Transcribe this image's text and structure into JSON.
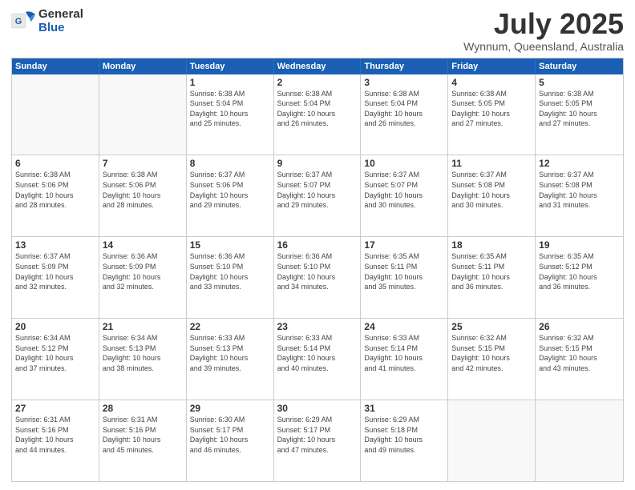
{
  "header": {
    "logo_general": "General",
    "logo_blue": "Blue",
    "month": "July 2025",
    "location": "Wynnum, Queensland, Australia"
  },
  "weekdays": [
    "Sunday",
    "Monday",
    "Tuesday",
    "Wednesday",
    "Thursday",
    "Friday",
    "Saturday"
  ],
  "weeks": [
    [
      {
        "day": "",
        "info": ""
      },
      {
        "day": "",
        "info": ""
      },
      {
        "day": "1",
        "info": "Sunrise: 6:38 AM\nSunset: 5:04 PM\nDaylight: 10 hours\nand 25 minutes."
      },
      {
        "day": "2",
        "info": "Sunrise: 6:38 AM\nSunset: 5:04 PM\nDaylight: 10 hours\nand 26 minutes."
      },
      {
        "day": "3",
        "info": "Sunrise: 6:38 AM\nSunset: 5:04 PM\nDaylight: 10 hours\nand 26 minutes."
      },
      {
        "day": "4",
        "info": "Sunrise: 6:38 AM\nSunset: 5:05 PM\nDaylight: 10 hours\nand 27 minutes."
      },
      {
        "day": "5",
        "info": "Sunrise: 6:38 AM\nSunset: 5:05 PM\nDaylight: 10 hours\nand 27 minutes."
      }
    ],
    [
      {
        "day": "6",
        "info": "Sunrise: 6:38 AM\nSunset: 5:06 PM\nDaylight: 10 hours\nand 28 minutes."
      },
      {
        "day": "7",
        "info": "Sunrise: 6:38 AM\nSunset: 5:06 PM\nDaylight: 10 hours\nand 28 minutes."
      },
      {
        "day": "8",
        "info": "Sunrise: 6:37 AM\nSunset: 5:06 PM\nDaylight: 10 hours\nand 29 minutes."
      },
      {
        "day": "9",
        "info": "Sunrise: 6:37 AM\nSunset: 5:07 PM\nDaylight: 10 hours\nand 29 minutes."
      },
      {
        "day": "10",
        "info": "Sunrise: 6:37 AM\nSunset: 5:07 PM\nDaylight: 10 hours\nand 30 minutes."
      },
      {
        "day": "11",
        "info": "Sunrise: 6:37 AM\nSunset: 5:08 PM\nDaylight: 10 hours\nand 30 minutes."
      },
      {
        "day": "12",
        "info": "Sunrise: 6:37 AM\nSunset: 5:08 PM\nDaylight: 10 hours\nand 31 minutes."
      }
    ],
    [
      {
        "day": "13",
        "info": "Sunrise: 6:37 AM\nSunset: 5:09 PM\nDaylight: 10 hours\nand 32 minutes."
      },
      {
        "day": "14",
        "info": "Sunrise: 6:36 AM\nSunset: 5:09 PM\nDaylight: 10 hours\nand 32 minutes."
      },
      {
        "day": "15",
        "info": "Sunrise: 6:36 AM\nSunset: 5:10 PM\nDaylight: 10 hours\nand 33 minutes."
      },
      {
        "day": "16",
        "info": "Sunrise: 6:36 AM\nSunset: 5:10 PM\nDaylight: 10 hours\nand 34 minutes."
      },
      {
        "day": "17",
        "info": "Sunrise: 6:35 AM\nSunset: 5:11 PM\nDaylight: 10 hours\nand 35 minutes."
      },
      {
        "day": "18",
        "info": "Sunrise: 6:35 AM\nSunset: 5:11 PM\nDaylight: 10 hours\nand 36 minutes."
      },
      {
        "day": "19",
        "info": "Sunrise: 6:35 AM\nSunset: 5:12 PM\nDaylight: 10 hours\nand 36 minutes."
      }
    ],
    [
      {
        "day": "20",
        "info": "Sunrise: 6:34 AM\nSunset: 5:12 PM\nDaylight: 10 hours\nand 37 minutes."
      },
      {
        "day": "21",
        "info": "Sunrise: 6:34 AM\nSunset: 5:13 PM\nDaylight: 10 hours\nand 38 minutes."
      },
      {
        "day": "22",
        "info": "Sunrise: 6:33 AM\nSunset: 5:13 PM\nDaylight: 10 hours\nand 39 minutes."
      },
      {
        "day": "23",
        "info": "Sunrise: 6:33 AM\nSunset: 5:14 PM\nDaylight: 10 hours\nand 40 minutes."
      },
      {
        "day": "24",
        "info": "Sunrise: 6:33 AM\nSunset: 5:14 PM\nDaylight: 10 hours\nand 41 minutes."
      },
      {
        "day": "25",
        "info": "Sunrise: 6:32 AM\nSunset: 5:15 PM\nDaylight: 10 hours\nand 42 minutes."
      },
      {
        "day": "26",
        "info": "Sunrise: 6:32 AM\nSunset: 5:15 PM\nDaylight: 10 hours\nand 43 minutes."
      }
    ],
    [
      {
        "day": "27",
        "info": "Sunrise: 6:31 AM\nSunset: 5:16 PM\nDaylight: 10 hours\nand 44 minutes."
      },
      {
        "day": "28",
        "info": "Sunrise: 6:31 AM\nSunset: 5:16 PM\nDaylight: 10 hours\nand 45 minutes."
      },
      {
        "day": "29",
        "info": "Sunrise: 6:30 AM\nSunset: 5:17 PM\nDaylight: 10 hours\nand 46 minutes."
      },
      {
        "day": "30",
        "info": "Sunrise: 6:29 AM\nSunset: 5:17 PM\nDaylight: 10 hours\nand 47 minutes."
      },
      {
        "day": "31",
        "info": "Sunrise: 6:29 AM\nSunset: 5:18 PM\nDaylight: 10 hours\nand 49 minutes."
      },
      {
        "day": "",
        "info": ""
      },
      {
        "day": "",
        "info": ""
      }
    ]
  ]
}
